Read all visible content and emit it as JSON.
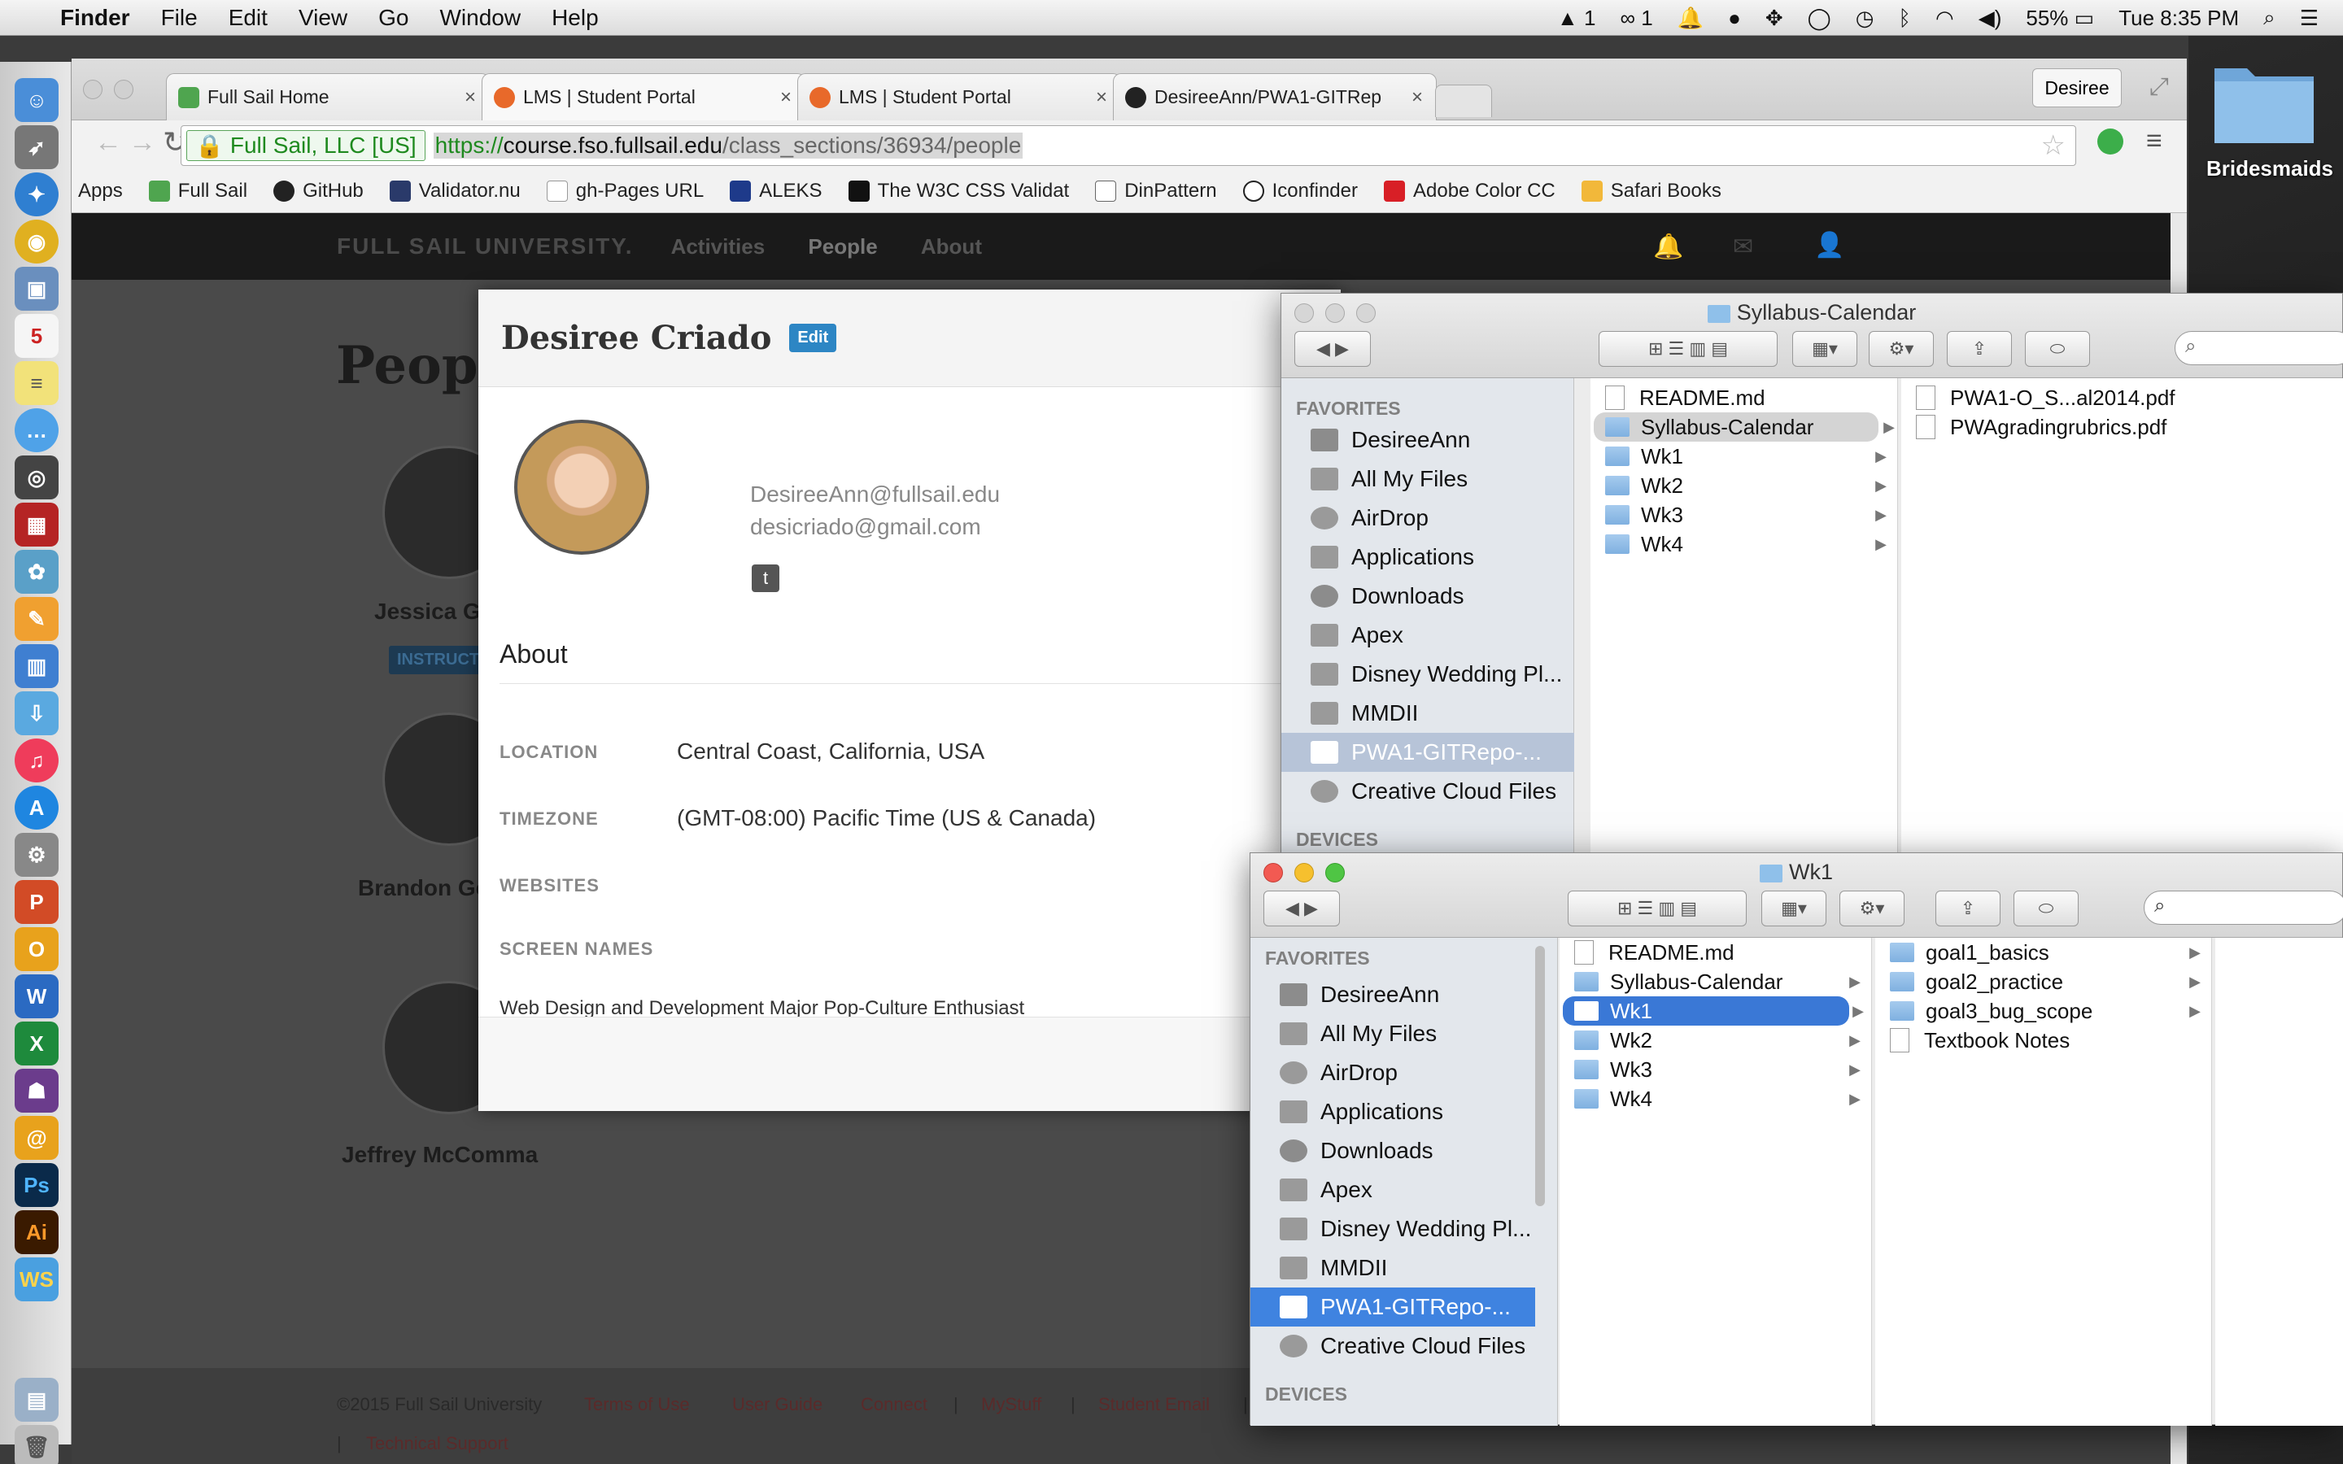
{
  "menubar": {
    "app": "Finder",
    "items": [
      "File",
      "Edit",
      "View",
      "Go",
      "Window",
      "Help"
    ],
    "adobe_count": "1",
    "cc_count": "1",
    "battery": "55%",
    "clock": "Tue 8:35 PM"
  },
  "desktop": {
    "folder_label": "Bridesmaids"
  },
  "browser": {
    "tabs": [
      {
        "title": "Full Sail Home",
        "close": "×"
      },
      {
        "title": "LMS | Student Portal",
        "close": "×"
      },
      {
        "title": "LMS | Student Portal",
        "close": "×"
      },
      {
        "title": "DesireeAnn/PWA1-GITRep",
        "close": "×"
      }
    ],
    "profile": "Desiree",
    "ev_cert": "Full Sail, LLC [US]",
    "url_proto": "https://",
    "url_host": "course.fso.fullsail.edu",
    "url_path": "/class_sections/36934/people",
    "bookmarks": [
      "Apps",
      "Full Sail",
      "GitHub",
      "Validator.nu",
      "gh-Pages URL",
      "ALEKS",
      "The W3C CSS Validat",
      "DinPattern",
      "Iconfinder",
      "Adobe Color CC",
      "Safari Books"
    ]
  },
  "page": {
    "logo": "FULL SAIL UNIVERSITY.",
    "nav": [
      "Activities",
      "People",
      "About"
    ],
    "title": "People",
    "people": [
      {
        "name": "Jessica Garlic",
        "badge": "INSTRUCTOR"
      },
      {
        "name": "Brandon Golden"
      },
      {
        "name": "Jeffrey McComma"
      }
    ],
    "footer": {
      "copyright": "©2015 Full Sail University",
      "links": [
        "Terms of Use",
        "User Guide",
        "Connect",
        "MyStuff",
        "Student Email",
        "Technical Support"
      ],
      "sep": "|"
    }
  },
  "modal": {
    "name": "Desiree Criado",
    "edit": "Edit",
    "email1": "DesireeAnn@fullsail.edu",
    "email2": "desicriado@gmail.com",
    "about": "About",
    "location_label": "LOCATION",
    "location": "Central Coast, California, USA",
    "timezone_label": "TIMEZONE",
    "timezone": "(GMT-08:00) Pacific Time (US & Canada)",
    "websites_label": "WEBSITES",
    "screennames_label": "SCREEN NAMES",
    "bio": "Web Design and Development Major Pop-Culture Enthusiast"
  },
  "finder_back": {
    "title": "Syllabus-Calendar",
    "favorites_head": "FAVORITES",
    "devices_head": "DEVICES",
    "sidebar": [
      "DesireeAnn",
      "All My Files",
      "AirDrop",
      "Applications",
      "Downloads",
      "Apex",
      "Disney Wedding Pl...",
      "MMDII",
      "PWA1-GITRepo-...",
      "Creative Cloud Files"
    ],
    "col1": [
      "README.md",
      "Syllabus-Calendar",
      "Wk1",
      "Wk2",
      "Wk3",
      "Wk4"
    ],
    "col2": [
      "PWA1-O_S...al2014.pdf",
      "PWAgradingrubrics.pdf"
    ]
  },
  "finder_front": {
    "title": "Wk1",
    "favorites_head": "FAVORITES",
    "devices_head": "DEVICES",
    "sidebar": [
      "DesireeAnn",
      "All My Files",
      "AirDrop",
      "Applications",
      "Downloads",
      "Apex",
      "Disney Wedding Pl...",
      "MMDII",
      "PWA1-GITRepo-...",
      "Creative Cloud Files"
    ],
    "col1": [
      "README.md",
      "Syllabus-Calendar",
      "Wk1",
      "Wk2",
      "Wk3",
      "Wk4"
    ],
    "col2": [
      "goal1_basics",
      "goal2_practice",
      "goal3_bug_scope",
      "Textbook Notes"
    ]
  },
  "colors": {
    "accent_blue": "#3a78d6",
    "edit_badge": "#2d86c4",
    "instructor_badge": "#1d3a52",
    "ev_green": "#1f8a1f"
  }
}
